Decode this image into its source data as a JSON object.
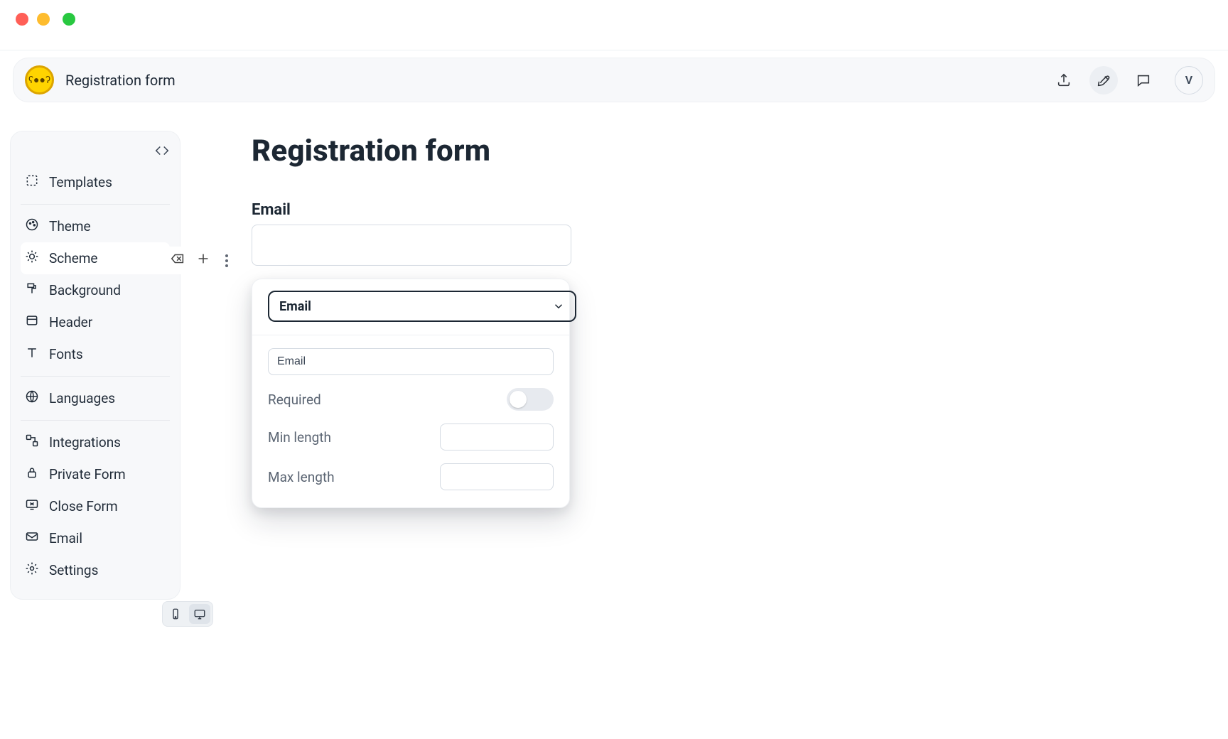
{
  "header": {
    "title": "Registration form",
    "avatar_initial": "V"
  },
  "sidebar": {
    "items": [
      {
        "label": "Templates"
      },
      {
        "label": "Theme"
      },
      {
        "label": "Scheme"
      },
      {
        "label": "Background"
      },
      {
        "label": "Header"
      },
      {
        "label": "Fonts"
      },
      {
        "label": "Languages"
      },
      {
        "label": "Integrations"
      },
      {
        "label": "Private Form"
      },
      {
        "label": "Close Form"
      },
      {
        "label": "Email"
      },
      {
        "label": "Settings"
      }
    ]
  },
  "canvas": {
    "title": "Registration form",
    "field": {
      "label": "Email"
    }
  },
  "popover": {
    "type_label": "Email",
    "name_value": "Email",
    "required_label": "Required",
    "min_label": "Min length",
    "max_label": "Max length"
  }
}
